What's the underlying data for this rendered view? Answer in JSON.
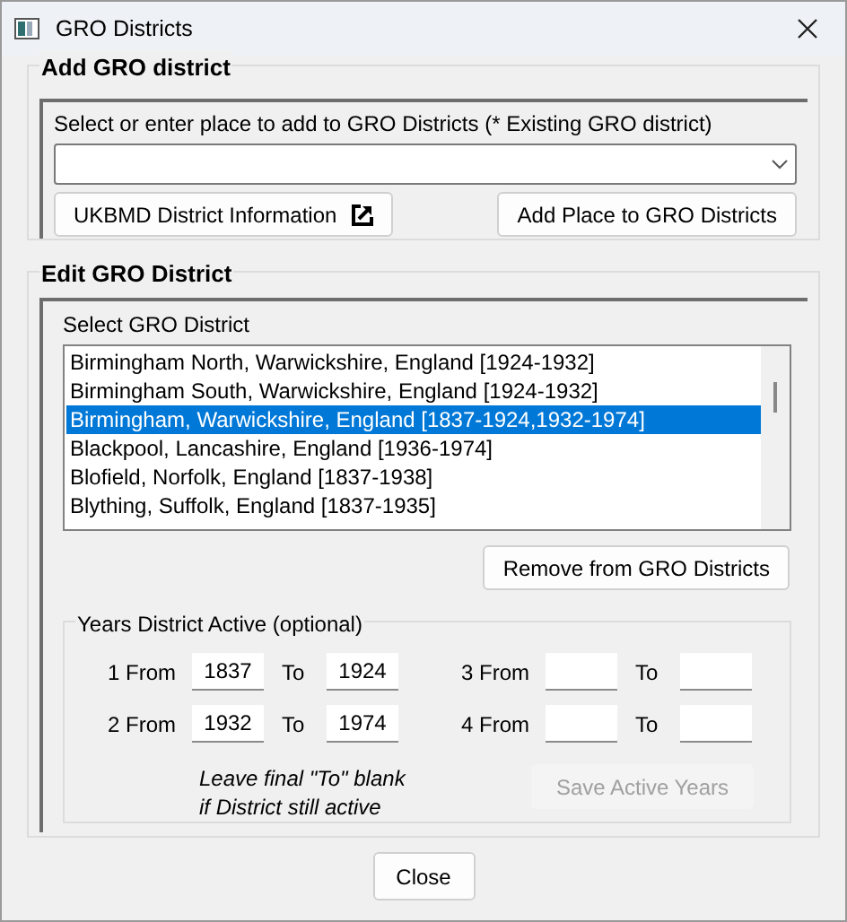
{
  "window": {
    "title": "GRO Districts"
  },
  "add_group": {
    "title": "Add GRO district",
    "combo_label": "Select or enter place to add to GRO Districts (* Existing GRO district)",
    "buttons": [
      {
        "label": "UKBMD District Information",
        "kind": "external"
      },
      {
        "label": "Add Place to GRO Districts",
        "kind": "plain"
      }
    ]
  },
  "edit_group": {
    "title": "Edit GRO District",
    "list_label": "Select GRO District",
    "items": [
      {
        "text": "Birmingham North, Warwickshire, England [1924-1932]",
        "selected": false
      },
      {
        "text": "Birmingham South, Warwickshire, England [1924-1932]",
        "selected": false
      },
      {
        "text": "Birmingham, Warwickshire, England [1837-1924,1932-1974]",
        "selected": true
      },
      {
        "text": "Blackpool, Lancashire, England [1936-1974]",
        "selected": false
      },
      {
        "text": "Blofield, Norfolk, England [1837-1938]",
        "selected": false
      },
      {
        "text": "Blything, Suffolk, England [1837-1935]",
        "selected": false
      }
    ],
    "remove_button": "Remove from GRO Districts",
    "years": {
      "title": "Years District Active (optional)",
      "periods": [
        {
          "label": "1 From",
          "to_label": "To",
          "from": "1837",
          "to": "1924"
        },
        {
          "label": "3 From",
          "to_label": "To"
        },
        {
          "label": "2 From",
          "to_label": "To",
          "from": "1932",
          "to": "1974"
        },
        {
          "label": "4 From",
          "to_label": "To"
        }
      ],
      "note": "Leave final \"To\" blank\nif District still active",
      "save_button": {
        "label": "Save Active Years",
        "disabled": true
      }
    }
  },
  "close_button": "Close"
}
